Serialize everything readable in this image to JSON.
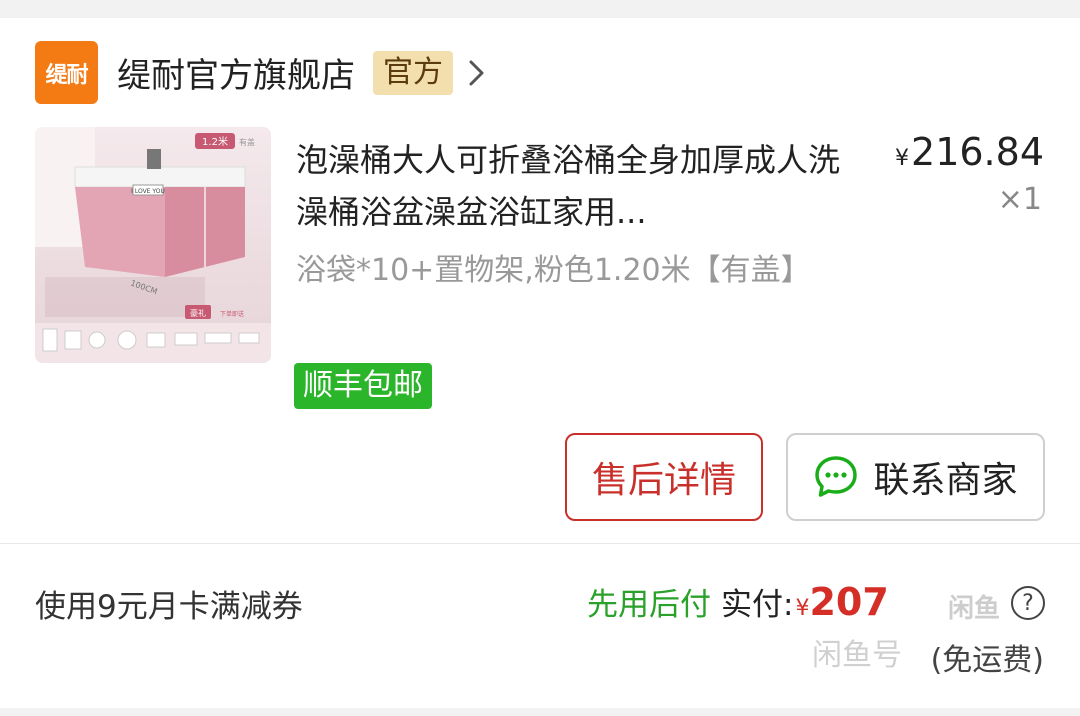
{
  "store": {
    "logo_text": "缇耐",
    "name": "缇耐官方旗舰店",
    "badge": "官方",
    "chevron_icon": "chevron-right-icon"
  },
  "product": {
    "title": "泡澡桶大人可折叠浴桶全身加厚成人洗澡桶浴盆澡盆浴缸家用...",
    "price_symbol": "¥",
    "price": "216.84",
    "quantity": "×1",
    "sku": "浴袋*10+置物架,粉色1.20米【有盖】",
    "shipping_badge": "顺丰包邮",
    "image": {
      "size_tag": "1.2米",
      "corner_tag": "有盖",
      "sign_text": "I LOVE YOU",
      "dimension_label": "100CM",
      "gift_label": "豪礼",
      "gift_sub": "下单即送"
    }
  },
  "actions": {
    "after_sales": "售后详情",
    "contact_seller": "联系商家",
    "chat_icon": "chat-bubble-icon"
  },
  "footer": {
    "coupon_text": "使用9元月卡满减券",
    "pay_later": "先用后付",
    "paid_label": "实付:",
    "paid_symbol": "¥",
    "paid_amount": "207",
    "help_icon": "question-circle-icon",
    "freight_note": "(免运费)"
  },
  "watermark": {
    "text": "闲鱼号",
    "logo": "闲鱼"
  },
  "colors": {
    "store_logo": "#f47b14",
    "official_badge_bg": "#f3dfae",
    "shipping_green": "#2bb52b",
    "after_sales_red": "#c9302c",
    "pay_later_green": "#2aa12a",
    "amount_red": "#d42e26"
  }
}
